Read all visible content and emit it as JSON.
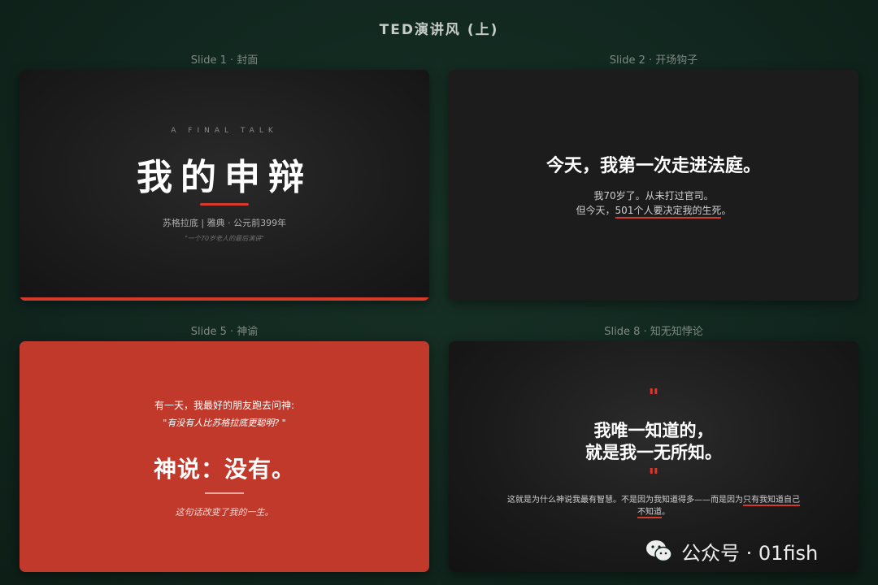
{
  "page": {
    "title": "TED演讲风 (上)"
  },
  "slides": [
    {
      "label": "Slide 1 · 封面",
      "eyebrow": "A FINAL TALK",
      "title": "我的申辩",
      "meta": "苏格拉底 | 雅典 · 公元前399年",
      "quote": "\"一个70岁老人的最后演讲\""
    },
    {
      "label": "Slide 2 · 开场钩子",
      "headline": "今天，我第一次走进法庭。",
      "line1": "我70岁了。从未打过官司。",
      "line2_prefix": "但今天，",
      "line2_highlight": "501个人要决定我的生死",
      "line2_suffix": "。"
    },
    {
      "label": "Slide 5 · 神谕",
      "line1": "有一天，我最好的朋友跑去问神:",
      "line2": "\"有没有人比苏格拉底更聪明? \"",
      "big": "神说：没有。",
      "foot": "这句话改变了我的一生。"
    },
    {
      "label": "Slide 8 · 知无知悖论",
      "open_quote": "\"",
      "quote_line1": "我唯一知道的，",
      "quote_line2": "就是我一无所知。",
      "close_quote": "\"",
      "body_prefix": "这就是为什么神说我最有智慧。不是因为我知道得多——而是因为",
      "body_highlight": "只有我知道自己不知道",
      "body_suffix": "。"
    }
  ],
  "watermark": {
    "text": "公众号 · 01fish",
    "icon": "wechat-icon"
  },
  "colors": {
    "background": "#11271f",
    "accent_red": "#d63a2a",
    "slide_red": "#c0392b"
  }
}
